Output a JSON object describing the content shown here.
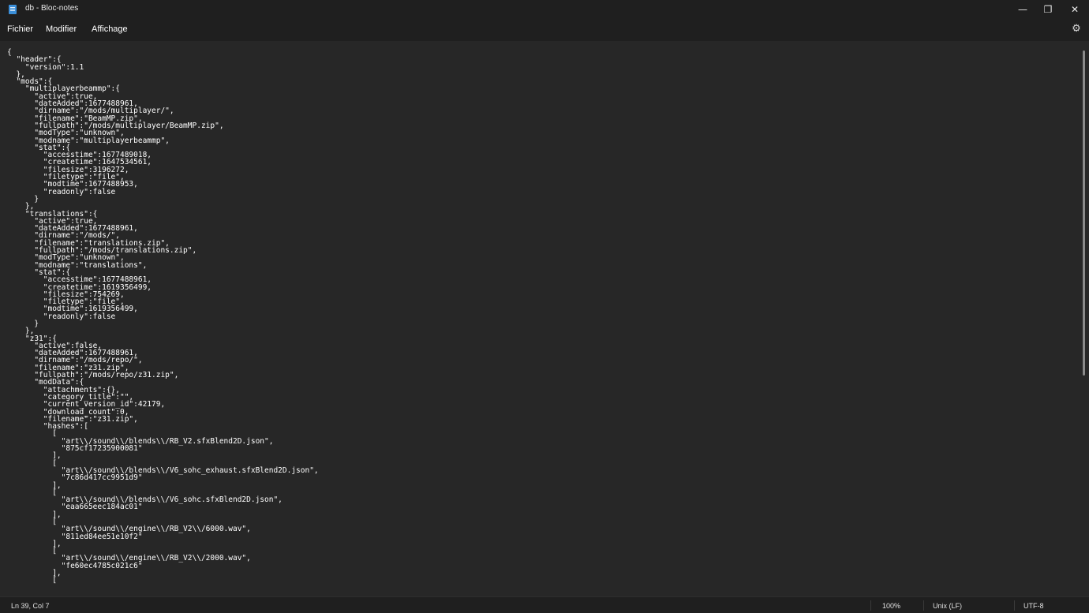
{
  "window": {
    "title": "db - Bloc-notes",
    "minimize_glyph": "—",
    "restore_glyph": "❐",
    "close_glyph": "✕"
  },
  "menu": {
    "items": [
      "Fichier",
      "Modifier",
      "Affichage"
    ],
    "settings_icon": "gear-icon"
  },
  "editor": {
    "lines": [
      "{",
      "  \"header\":{",
      "    \"version\":1.1",
      "  },",
      "  \"mods\":{",
      "    \"multiplayerbeammp\":{",
      "      \"active\":true,",
      "      \"dateAdded\":1677488961,",
      "      \"dirname\":\"/mods/multiplayer/\",",
      "      \"filename\":\"BeamMP.zip\",",
      "      \"fullpath\":\"/mods/multiplayer/BeamMP.zip\",",
      "      \"modType\":\"unknown\",",
      "      \"modname\":\"multiplayerbeammp\",",
      "      \"stat\":{",
      "        \"accesstime\":1677489018,",
      "        \"createtime\":1647534561,",
      "        \"filesize\":3196272,",
      "        \"filetype\":\"file\",",
      "        \"modtime\":1677488953,",
      "        \"readonly\":false",
      "      }",
      "    },",
      "    \"translations\":{",
      "      \"active\":true,",
      "      \"dateAdded\":1677488961,",
      "      \"dirname\":\"/mods/\",",
      "      \"filename\":\"translations.zip\",",
      "      \"fullpath\":\"/mods/translations.zip\",",
      "      \"modType\":\"unknown\",",
      "      \"modname\":\"translations\",",
      "      \"stat\":{",
      "        \"accesstime\":1677488961,",
      "        \"createtime\":1619356499,",
      "        \"filesize\":754269,",
      "        \"filetype\":\"file\",",
      "        \"modtime\":1619356499,",
      "        \"readonly\":false",
      "      }",
      "    },",
      "    \"z31\":{",
      "      \"active\":false,",
      "      \"dateAdded\":1677488961,",
      "      \"dirname\":\"/mods/repo/\",",
      "      \"filename\":\"z31.zip\",",
      "      \"fullpath\":\"/mods/repo/z31.zip\",",
      "      \"modData\":{",
      "        \"attachments\":{},",
      "        \"category_title\":\"\",",
      "        \"current_version_id\":42179,",
      "        \"download_count\":0,",
      "        \"filename\":\"z31.zip\",",
      "        \"hashes\":[",
      "          [",
      "            \"art\\\\/sound\\\\/blends\\\\/RB_V2.sfxBlend2D.json\",",
      "            \"875cf17235900081\"",
      "          ],",
      "          [",
      "            \"art\\\\/sound\\\\/blends\\\\/V6_sohc_exhaust.sfxBlend2D.json\",",
      "            \"7c86d417cc9951d9\"",
      "          ],",
      "          [",
      "            \"art\\\\/sound\\\\/blends\\\\/V6_sohc.sfxBlend2D.json\",",
      "            \"eaa665eec184ac01\"",
      "          ],",
      "          [",
      "            \"art\\\\/sound\\\\/engine\\\\/RB_V2\\\\/6000.wav\",",
      "            \"811ed84ee51e10f2\"",
      "          ],",
      "          [",
      "            \"art\\\\/sound\\\\/engine\\\\/RB_V2\\\\/2000.wav\",",
      "            \"fe60ec4785c021c6\"",
      "          ],",
      "          ["
    ]
  },
  "status": {
    "position": "Ln 39, Col 7",
    "zoom": "100%",
    "line_ending": "Unix (LF)",
    "encoding": "UTF-8"
  }
}
